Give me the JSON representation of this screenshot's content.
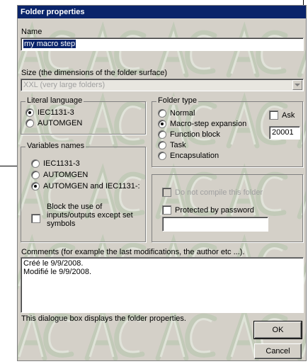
{
  "dialog": {
    "title": "Folder properties",
    "name_label": "Name",
    "name_value": "my macro step",
    "size_label": "Size (the dimensions of the folder surface)",
    "size_value": "XXL (very large folders)",
    "literal_language": {
      "label": "Literal language",
      "options": [
        "IEC1131-3",
        "AUTOMGEN"
      ],
      "selected": "IEC1131-3"
    },
    "folder_type": {
      "label": "Folder type",
      "options": [
        "Normal",
        "Macro-step expansion",
        "Function block",
        "Task",
        "Encapsulation"
      ],
      "selected": "Macro-step expansion",
      "ask_label": "Ask",
      "number_value": "20001"
    },
    "variables_names": {
      "label": "Variables names",
      "options": [
        "IEC1131-3",
        "AUTOMGEN",
        "AUTOMGEN and IEC1131-:"
      ],
      "selected": "AUTOMGEN and IEC1131-:",
      "block_label": "Block the use of\ninputs/outputs except set\nsymbols"
    },
    "compile_label": "Do not compile this folder",
    "password_label": "Protected by password",
    "password_value": "",
    "comments_label": "Comments (for example the last modifications, the author etc ...).",
    "comments_value": "Créé le 9/9/2008.\nModifié le 9/9/2008.",
    "status_text": "This dialogue box displays the folder properties.",
    "ok_label": "OK",
    "cancel_label": "Cancel"
  },
  "colors": {
    "title_bar": "#0a246a",
    "dialog_face": "#d4d0c8",
    "watermark": "#a9b8a0"
  },
  "icons": {
    "combo_arrow": "triangle-down"
  }
}
